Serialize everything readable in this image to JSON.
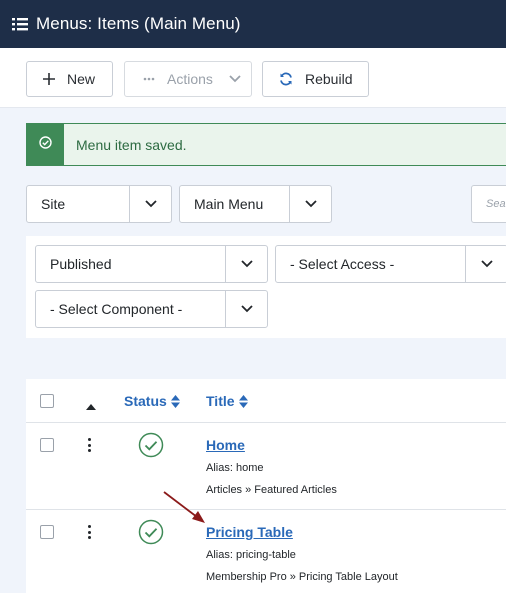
{
  "header": {
    "title": "Menus: Items (Main Menu)",
    "icon": "list-icon"
  },
  "toolbar": {
    "new_label": "New",
    "actions_label": "Actions",
    "rebuild_label": "Rebuild"
  },
  "alert": {
    "message": "Menu item saved.",
    "icon": "check-circle-icon"
  },
  "filters": {
    "client": "Site",
    "menu": "Main Menu",
    "search_placeholder": "Sea",
    "published": "Published",
    "access": "- Select Access -",
    "component": "- Select Component -"
  },
  "table": {
    "columns": {
      "status": "Status",
      "title": "Title"
    },
    "rows": [
      {
        "title": "Home",
        "alias": "Alias: home",
        "type": "Articles » Featured Articles",
        "status": "published"
      },
      {
        "title": "Pricing Table",
        "alias": "Alias: pricing-table",
        "type": "Membership Pro » Pricing Table Layout",
        "status": "published"
      }
    ]
  },
  "colors": {
    "header_bg": "#1e2e48",
    "link": "#2a69b8",
    "success": "#3f8a57",
    "annotation_arrow": "#8b1a1a"
  }
}
